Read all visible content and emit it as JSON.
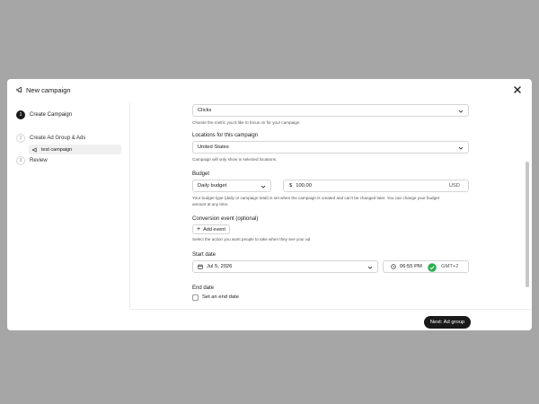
{
  "modal": {
    "title": "New campaign",
    "title_icon": "megaphone-icon",
    "close_icon": "close-icon"
  },
  "sidebar": {
    "steps": [
      {
        "number": "1",
        "label": "Create Campaign",
        "active": true
      },
      {
        "number": "2",
        "label": "Create Ad Group & Ads",
        "active": false
      },
      {
        "number": "3",
        "label": "Review",
        "active": false
      }
    ],
    "sub_item": {
      "label": "test campaign",
      "icon": "megaphone-icon"
    }
  },
  "form": {
    "metric": {
      "value": "Clicks",
      "helper": "Choose the metric you'd like to focus on for your campaign"
    },
    "locations": {
      "label": "Locations for this campaign",
      "value": "United States",
      "helper": "Campaign will only show in selected locations."
    },
    "budget": {
      "label": "Budget",
      "type": "Daily budget",
      "currency_symbol": "$",
      "amount": "100.00",
      "currency": "USD",
      "helper_line1": "Your budget type (daily or campaign total) is set when the campaign is created and can't be changed later. You can change your budget",
      "helper_line2": "amount at any time."
    },
    "conversion": {
      "label": "Conversion event (optional)",
      "add_label": "Add event",
      "helper": "Select the action you want people to take when they see your ad"
    },
    "start_date": {
      "label": "Start date",
      "date": "Jul 5, 2026",
      "time": "06:55 PM",
      "timezone": "GMT+2"
    },
    "end_date": {
      "label": "End date",
      "checkbox_label": "Set an end date",
      "checked": false
    }
  },
  "footer": {
    "next_label": "Next: Ad group"
  },
  "colors": {
    "backdrop": "#a6a6a6",
    "primary": "#1a1a1a",
    "success": "#2fae4f"
  }
}
